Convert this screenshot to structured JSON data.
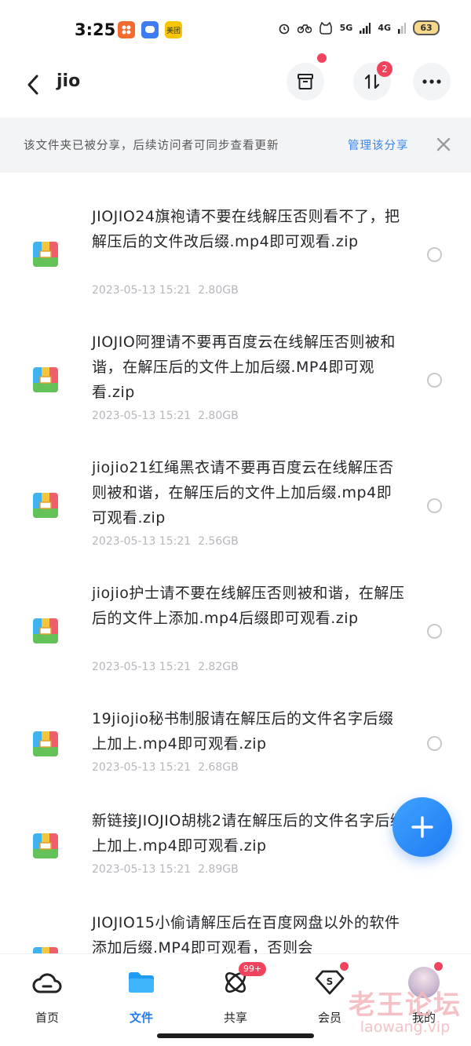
{
  "status_bar": {
    "time": "3:25",
    "badges": [
      {
        "label": "",
        "color": "#f26a2e"
      },
      {
        "label": "",
        "color": "#3d7cf2"
      },
      {
        "label": "美团",
        "color": "#f7c600"
      }
    ],
    "network": "5G",
    "network2": "4G",
    "battery": "63"
  },
  "header": {
    "title": "jio",
    "transfer_count": "2"
  },
  "share_notice": {
    "text": "该文件夹已被分享，后续访问者可同步查看更新",
    "manage_label": "管理该分享"
  },
  "files": [
    {
      "name": "JIOJIO24旗袍请不要在线解压否则看不了，把解压后的文件改后缀.mp4即可观看.zip",
      "date": "2023-05-13  15:21",
      "size": "2.80GB"
    },
    {
      "name": "JIOJIO阿狸请不要再百度云在线解压否则被和谐，在解压后的文件上加后缀.MP4即可观看.zip",
      "date": "2023-05-13  15:21",
      "size": "2.80GB"
    },
    {
      "name": "jiojio21红绳黑衣请不要再百度云在线解压否则被和谐，在解压后的文件上加后缀.mp4即可观看.zip",
      "date": "2023-05-13  15:21",
      "size": "2.56GB"
    },
    {
      "name": "jiojio护士请不要在线解压否则被和谐，在解压后的文件上添加.mp4后缀即可观看.zip",
      "date": "2023-05-13  15:21",
      "size": "2.82GB"
    },
    {
      "name": "19jiojio秘书制服请在解压后的文件名字后缀上加上.mp4即可观看.zip",
      "date": "2023-05-13  15:21",
      "size": "2.68GB"
    },
    {
      "name": "新链接JIOJIO胡桃2请在解压后的文件名字后缀上加上.mp4即可观看.zip",
      "date": "2023-05-13  15:21",
      "size": "2.89GB"
    },
    {
      "name": "JIOJIO15小偷请解压后在百度网盘以外的软件添加后缀.MP4即可观看，否则会",
      "date": "",
      "size": ""
    }
  ],
  "nav": {
    "home": "首页",
    "files": "文件",
    "share": "共享",
    "share_badge": "99+",
    "vip": "会员",
    "mine": "我的"
  },
  "watermark": {
    "cn": "老王论坛",
    "en": "laowang.vip"
  }
}
